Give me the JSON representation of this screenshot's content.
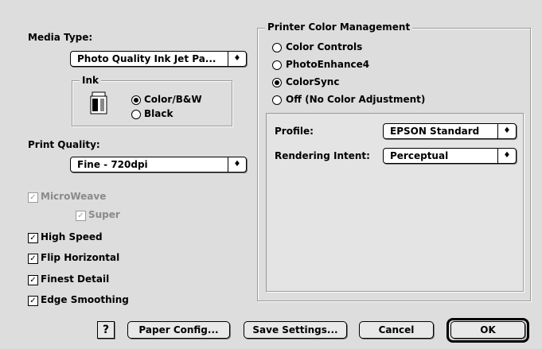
{
  "media": {
    "label": "Media Type:",
    "value": "Photo Quality Ink Jet Pa...",
    "arrow": "♦"
  },
  "ink": {
    "title": "Ink",
    "icon": "ink-cartridge-icon",
    "options": [
      "Color/B&W",
      "Black"
    ],
    "selected": "Color/B&W"
  },
  "quality": {
    "label": "Print Quality:",
    "value": "Fine - 720dpi",
    "arrow": "♦"
  },
  "checkboxes": {
    "microweave": "MicroWeave",
    "super": "Super",
    "high_speed": "High Speed",
    "flip_horizontal": "Flip Horizontal",
    "finest_detail": "Finest Detail",
    "edge_smoothing": "Edge Smoothing",
    "check_mark": "✓"
  },
  "color_mgmt": {
    "title": "Printer Color Management",
    "options": [
      "Color Controls",
      "PhotoEnhance4",
      "ColorSync",
      "Off (No Color Adjustment)"
    ],
    "selected": "ColorSync",
    "profile_label": "Profile:",
    "profile_value": "EPSON Standard",
    "intent_label": "Rendering Intent:",
    "intent_value": "Perceptual",
    "arrow": "♦"
  },
  "buttons": {
    "help": "?",
    "paper_config": "Paper Config...",
    "save_settings": "Save Settings...",
    "cancel": "Cancel",
    "ok": "OK"
  }
}
